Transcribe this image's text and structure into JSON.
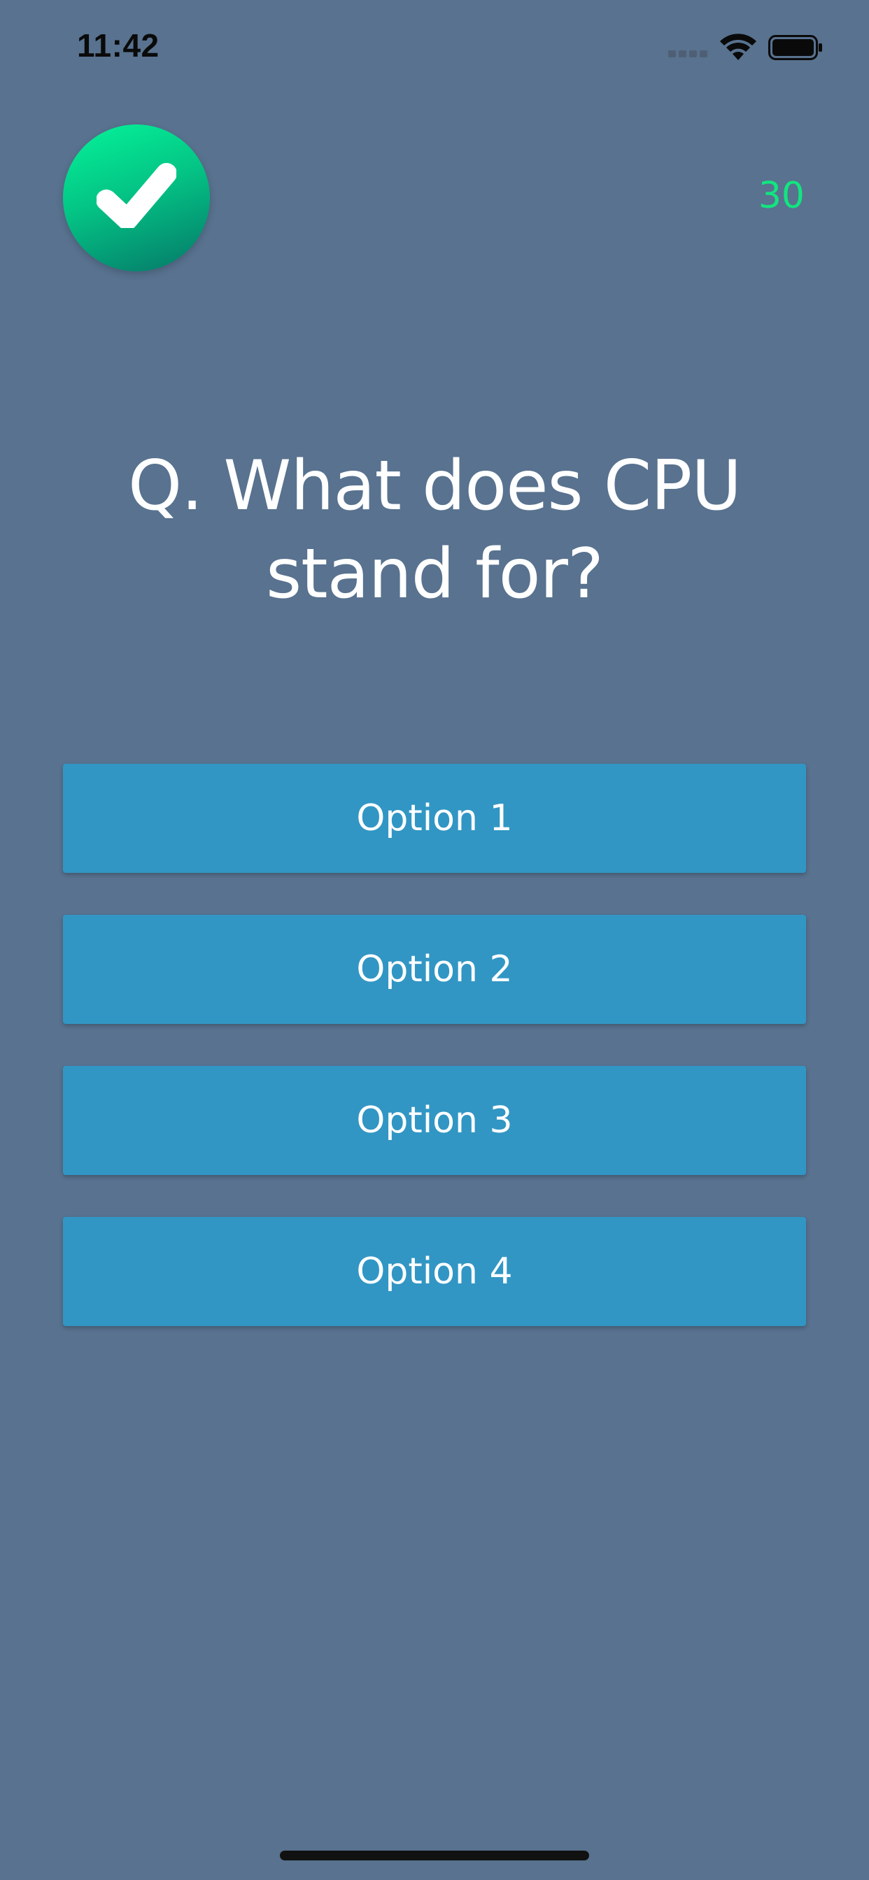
{
  "status_bar": {
    "time": "11:42",
    "icons": [
      "cellular-signal-icon",
      "wifi-icon",
      "battery-icon"
    ]
  },
  "header": {
    "badge_icon": "checkmark-icon",
    "timer_value": "30"
  },
  "question": {
    "text": "Q. What does CPU stand for?"
  },
  "options": [
    {
      "label": "Option 1"
    },
    {
      "label": "Option 2"
    },
    {
      "label": "Option 3"
    },
    {
      "label": "Option 4"
    }
  ],
  "colors": {
    "background": "#58728f",
    "option_button": "#3196c4",
    "timer": "#12e57f",
    "badge_gradient_start": "#05f49a",
    "badge_gradient_end": "#057768"
  }
}
